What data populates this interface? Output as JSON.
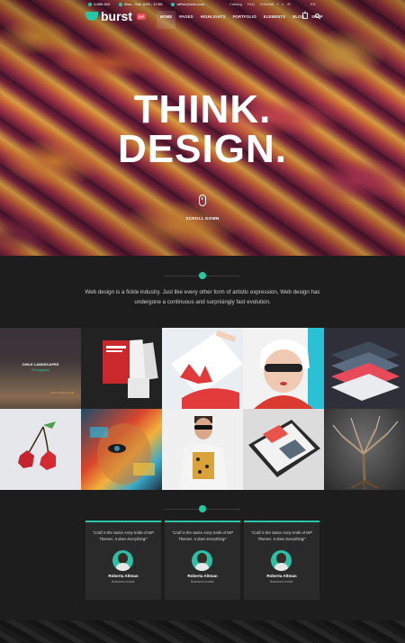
{
  "colors": {
    "accent": "#27c7a6",
    "badge": "#e94e5c",
    "background": "#1a1a1a"
  },
  "topbar": {
    "logo_text": "burst",
    "logo_badge": "WP",
    "contact": [
      "1-500-012",
      "Mon - Sat: 8:00 - 17:00",
      "office@site.com"
    ],
    "links": [
      "Catalog",
      "FAQ",
      "Editorial"
    ],
    "social_icons": [
      "facebook-icon",
      "twitter-icon",
      "vimeo-icon",
      "email-icon"
    ],
    "social_glyphs": [
      "f",
      "t",
      "v",
      "✉"
    ],
    "lang": "EN",
    "cart_count": "0"
  },
  "nav": {
    "items": [
      "HOME",
      "PAGES",
      "HIGHLIGHTS",
      "PORTFOLIO",
      "ELEMENTS",
      "BLOG",
      "SHOP"
    ],
    "active": "HOME"
  },
  "hero": {
    "line1": "THINK.",
    "line2": "DESIGN.",
    "scroll_label": "SCROLL DOWN"
  },
  "intro": {
    "text": "Web design is a fickle industry. Just like every other form of artistic expression, Web design has undergone a continuous and surprisingly fast evolution."
  },
  "portfolio": {
    "featured": {
      "title": "CHILE LANDSCAPES",
      "category": "Photography",
      "caption": "Green Orange Pink"
    },
    "tiles": [
      "chile-landscapes",
      "we-are-creative-print",
      "brand-identity",
      "girl-sunglasses",
      "stacked-ui",
      "low-poly-cherry",
      "painted-face",
      "man-sunglasses",
      "tablet-app",
      "fractal-tree"
    ]
  },
  "testimonials": [
    {
      "quote": "\"Craft is the Swiss Army Knife of WP Themes. It does Everything!\"",
      "name": "Roberta Altman",
      "role": "Business Insider"
    },
    {
      "quote": "\"Craft is the Swiss Army Knife of WP Themes. It does Everything!\"",
      "name": "Roberta Altman",
      "role": "Business Insider"
    },
    {
      "quote": "\"Craft is the Swiss Army Knife of WP Themes. It does Everything!\"",
      "name": "Roberta Altman",
      "role": "Business Insider"
    }
  ]
}
